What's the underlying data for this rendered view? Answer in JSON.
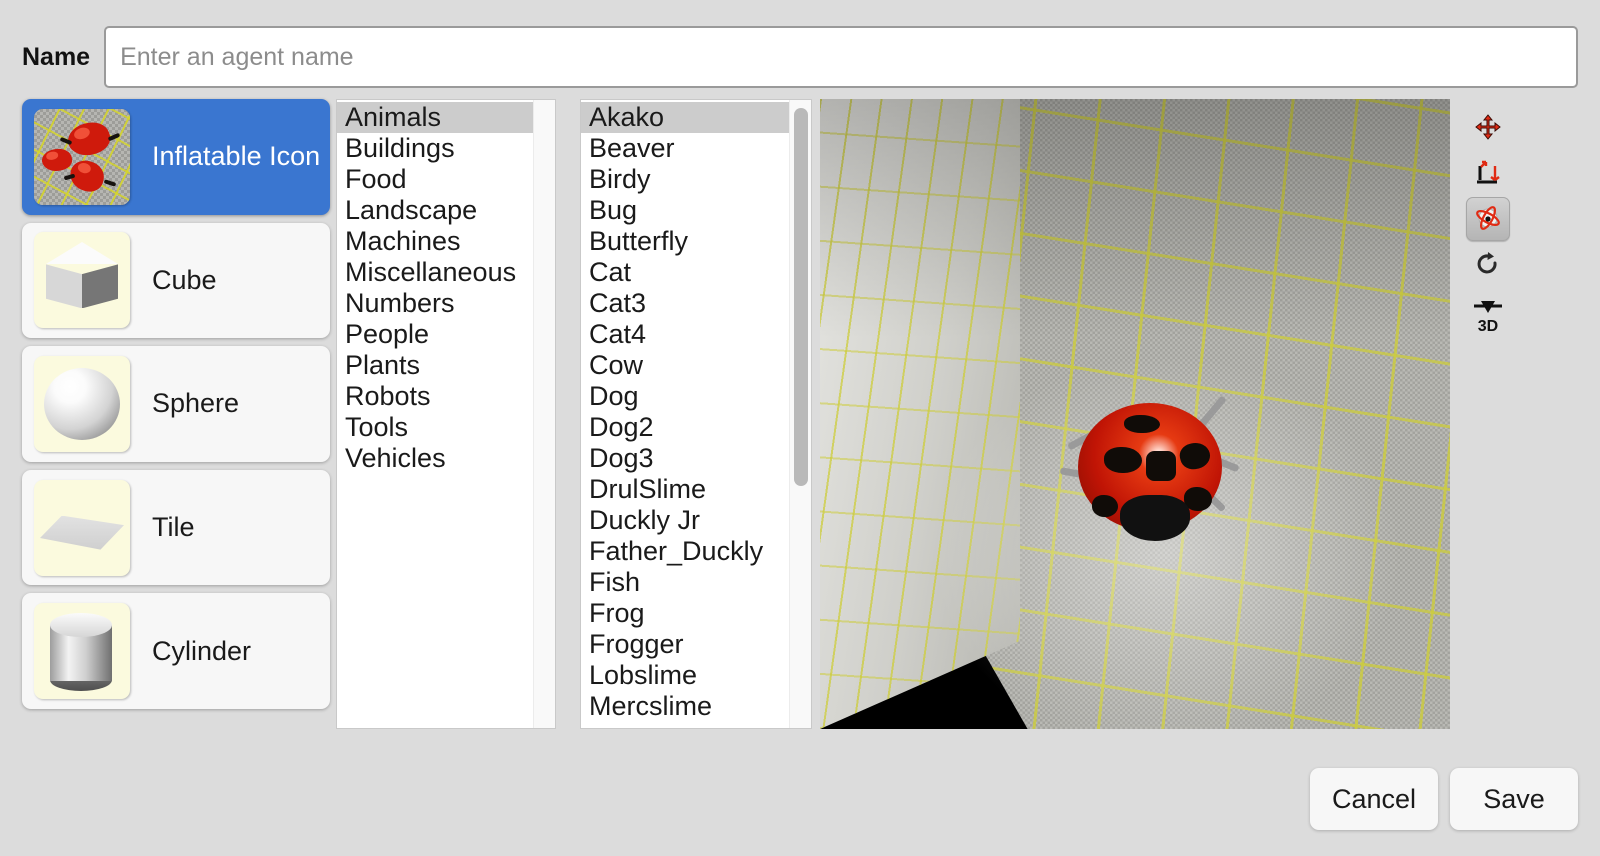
{
  "form": {
    "name_label": "Name",
    "name_value": "",
    "name_placeholder": "Enter an agent name"
  },
  "shapes": [
    {
      "label": "Inflatable Icon",
      "icon": "inflatable-icon-thumbnail",
      "selected": true
    },
    {
      "label": "Cube",
      "icon": "cube-thumbnail",
      "selected": false
    },
    {
      "label": "Sphere",
      "icon": "sphere-thumbnail",
      "selected": false
    },
    {
      "label": "Tile",
      "icon": "tile-thumbnail",
      "selected": false
    },
    {
      "label": "Cylinder",
      "icon": "cylinder-thumbnail",
      "selected": false
    }
  ],
  "categories": {
    "selected": "Animals",
    "items": [
      "Animals",
      "Buildings",
      "Food",
      "Landscape",
      "Machines",
      "Miscellaneous",
      "Numbers",
      "People",
      "Plants",
      "Robots",
      "Tools",
      "Vehicles"
    ]
  },
  "items": {
    "selected": "Akako",
    "items": [
      "Akako",
      "Beaver",
      "Birdy",
      "Bug",
      "Butterfly",
      "Cat",
      "Cat3",
      "Cat4",
      "Cow",
      "Dog",
      "Dog2",
      "Dog3",
      "DrulSlime",
      "Duckly Jr",
      "Father_Duckly",
      "Fish",
      "Frog",
      "Frogger",
      "Lobslime",
      "Mercslime"
    ]
  },
  "viewport": {
    "scene": "3d-room-preview",
    "model": "ladybug"
  },
  "tools": [
    {
      "name": "move-tool",
      "title": "Move",
      "active": false
    },
    {
      "name": "scale-tool",
      "title": "Scale",
      "active": false
    },
    {
      "name": "rotate-tool",
      "title": "Rotate",
      "active": true
    },
    {
      "name": "reset-tool",
      "title": "Reset",
      "active": false
    },
    {
      "name": "view-3d-tool",
      "title": "3D",
      "active": false,
      "label": "3D"
    }
  ],
  "footer": {
    "cancel_label": "Cancel",
    "save_label": "Save"
  },
  "colors": {
    "selection_blue": "#3a76d0",
    "list_selection_gray": "#cccccc",
    "background": "#dcdcdc",
    "thumb_yellow": "#fbfade",
    "tool_accent_red": "#e02b14"
  }
}
